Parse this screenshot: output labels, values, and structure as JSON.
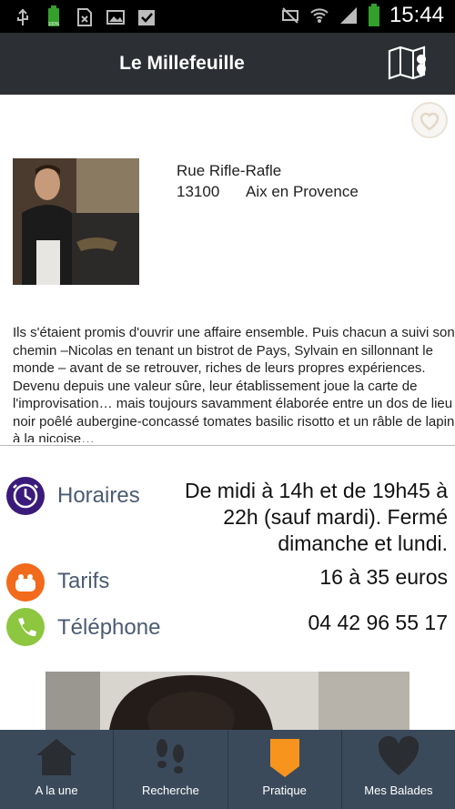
{
  "status_bar": {
    "time": "15:44",
    "battery_small_label": "100%"
  },
  "app_bar": {
    "title": "Le Millefeuille",
    "map_icon": "map-pin-icon"
  },
  "place": {
    "street": "Rue Rifle-Rafle",
    "postcode": "13100",
    "city": "Aix en Provence",
    "description": "Ils s'étaient promis d'ouvrir une affaire ensemble. Puis chacun a suivi son chemin –Nicolas en tenant un bistrot de Pays, Sylvain en sillonnant le monde – avant de se retrouver, riches de leurs propres expériences. Devenu depuis une valeur sûre, leur établissement joue la carte de l'improvisation… mais toujours savamment élaborée entre un dos de lieu noir poêlé aubergine-concassé tomates basilic risotto et un râble de lapin à la niçoise…"
  },
  "info": {
    "hours": {
      "label": "Horaires",
      "value": "De midi à 14h et de 19h45 à 22h (sauf mardi). Fermé dimanche et lundi.",
      "icon": "clock-icon",
      "color": "#3a1a7a"
    },
    "prices": {
      "label": "Tarifs",
      "value": "16 à 35 euros",
      "icon": "purse-icon",
      "color": "#f26a1b"
    },
    "phone": {
      "label": "Téléphone",
      "value": "04 42 96 55 17",
      "icon": "phone-icon",
      "color": "#8dc63f"
    }
  },
  "tabs": [
    {
      "label": "A la une",
      "icon": "home-icon",
      "active": false
    },
    {
      "label": "Recherche",
      "icon": "footprints-icon",
      "active": false
    },
    {
      "label": "Pratique",
      "icon": "tag-icon",
      "active": true
    },
    {
      "label": "Mes Balades",
      "icon": "heart-icon",
      "active": false
    }
  ],
  "colors": {
    "accent": "#f7941d",
    "tabbar": "#3b4a5b",
    "appbar": "#2c2f33"
  }
}
